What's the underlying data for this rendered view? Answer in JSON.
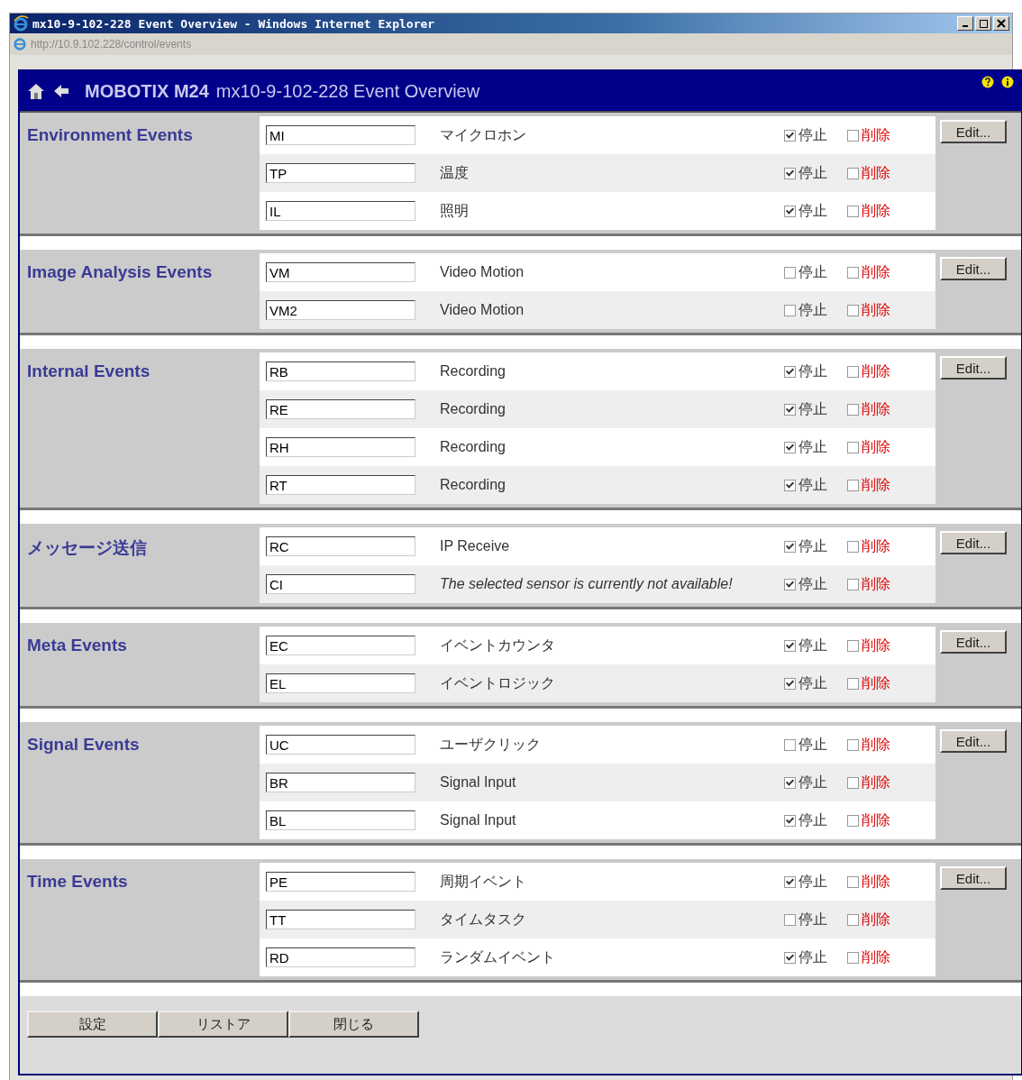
{
  "window": {
    "title": "mx10-9-102-228 Event Overview - Windows Internet Explorer",
    "address": "http://10.9.102.228/control/events"
  },
  "header": {
    "brand": "MOBOTIX M24",
    "title": "mx10-9-102-228 Event Overview"
  },
  "sections": [
    {
      "title": "Environment Events",
      "edit_button": "Edit...",
      "rows": [
        {
          "code": "MI",
          "description": "マイクロホン",
          "available": true,
          "stop_label": "停止",
          "stop_checked": true,
          "delete_label": "削除",
          "delete_checked": false
        },
        {
          "code": "TP",
          "description": "温度",
          "available": true,
          "stop_label": "停止",
          "stop_checked": true,
          "delete_label": "削除",
          "delete_checked": false
        },
        {
          "code": "IL",
          "description": "照明",
          "available": true,
          "stop_label": "停止",
          "stop_checked": true,
          "delete_label": "削除",
          "delete_checked": false
        }
      ]
    },
    {
      "title": "Image Analysis Events",
      "edit_button": "Edit...",
      "rows": [
        {
          "code": "VM",
          "description": "Video Motion",
          "available": true,
          "stop_label": "停止",
          "stop_checked": false,
          "delete_label": "削除",
          "delete_checked": false
        },
        {
          "code": "VM2",
          "description": "Video Motion",
          "available": true,
          "stop_label": "停止",
          "stop_checked": false,
          "delete_label": "削除",
          "delete_checked": false
        }
      ]
    },
    {
      "title": "Internal Events",
      "edit_button": "Edit...",
      "rows": [
        {
          "code": "RB",
          "description": "Recording",
          "available": true,
          "stop_label": "停止",
          "stop_checked": true,
          "delete_label": "削除",
          "delete_checked": false
        },
        {
          "code": "RE",
          "description": "Recording",
          "available": true,
          "stop_label": "停止",
          "stop_checked": true,
          "delete_label": "削除",
          "delete_checked": false
        },
        {
          "code": "RH",
          "description": "Recording",
          "available": true,
          "stop_label": "停止",
          "stop_checked": true,
          "delete_label": "削除",
          "delete_checked": false
        },
        {
          "code": "RT",
          "description": "Recording",
          "available": true,
          "stop_label": "停止",
          "stop_checked": true,
          "delete_label": "削除",
          "delete_checked": false
        }
      ]
    },
    {
      "title": "メッセージ送信",
      "edit_button": "Edit...",
      "rows": [
        {
          "code": "RC",
          "description": "IP Receive",
          "available": true,
          "stop_label": "停止",
          "stop_checked": true,
          "delete_label": "削除",
          "delete_checked": false
        },
        {
          "code": "CI",
          "description": "The selected sensor is currently not available!",
          "available": false,
          "stop_label": "停止",
          "stop_checked": true,
          "delete_label": "削除",
          "delete_checked": false
        }
      ]
    },
    {
      "title": "Meta Events",
      "edit_button": "Edit...",
      "rows": [
        {
          "code": "EC",
          "description": "イベントカウンタ",
          "available": true,
          "stop_label": "停止",
          "stop_checked": true,
          "delete_label": "削除",
          "delete_checked": false
        },
        {
          "code": "EL",
          "description": "イベントロジック",
          "available": true,
          "stop_label": "停止",
          "stop_checked": true,
          "delete_label": "削除",
          "delete_checked": false
        }
      ]
    },
    {
      "title": "Signal Events",
      "edit_button": "Edit...",
      "rows": [
        {
          "code": "UC",
          "description": "ユーザクリック",
          "available": true,
          "stop_label": "停止",
          "stop_checked": false,
          "delete_label": "削除",
          "delete_checked": false
        },
        {
          "code": "BR",
          "description": "Signal Input",
          "available": true,
          "stop_label": "停止",
          "stop_checked": true,
          "delete_label": "削除",
          "delete_checked": false
        },
        {
          "code": "BL",
          "description": "Signal Input",
          "available": true,
          "stop_label": "停止",
          "stop_checked": true,
          "delete_label": "削除",
          "delete_checked": false
        }
      ]
    },
    {
      "title": "Time Events",
      "edit_button": "Edit...",
      "rows": [
        {
          "code": "PE",
          "description": "周期イベント",
          "available": true,
          "stop_label": "停止",
          "stop_checked": true,
          "delete_label": "削除",
          "delete_checked": false
        },
        {
          "code": "TT",
          "description": "タイムタスク",
          "available": true,
          "stop_label": "停止",
          "stop_checked": false,
          "delete_label": "削除",
          "delete_checked": false
        },
        {
          "code": "RD",
          "description": "ランダムイベント",
          "available": true,
          "stop_label": "停止",
          "stop_checked": true,
          "delete_label": "削除",
          "delete_checked": false
        }
      ]
    }
  ],
  "buttons": [
    "設定",
    "リストア",
    "閉じる"
  ]
}
